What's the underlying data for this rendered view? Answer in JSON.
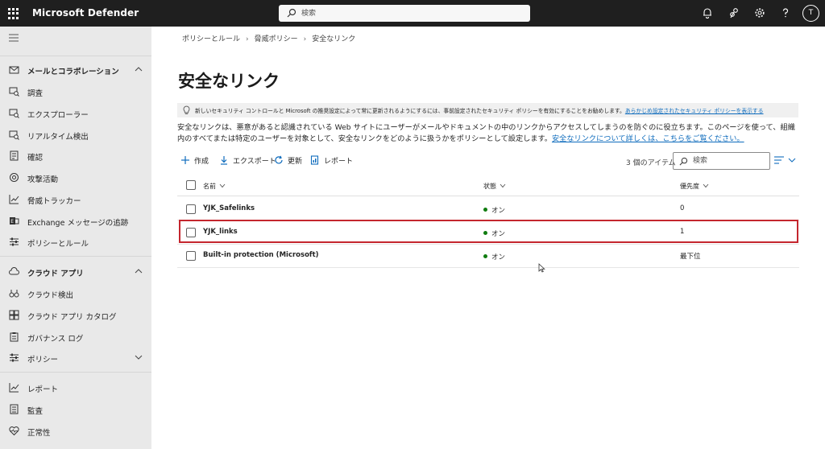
{
  "app": {
    "title": "Microsoft Defender",
    "search_placeholder": "検索",
    "avatar_initial": "T"
  },
  "sidebar": {
    "items": [
      {
        "label": "メールとコラボレーション",
        "group": true,
        "icon": "mail-icon"
      },
      {
        "label": "調査",
        "icon": "investigation-icon"
      },
      {
        "label": "エクスプローラー",
        "icon": "explorer-icon"
      },
      {
        "label": "リアルタイム検出",
        "icon": "realtime-icon"
      },
      {
        "label": "確認",
        "icon": "review-icon"
      },
      {
        "label": "攻撃活動",
        "icon": "campaign-icon"
      },
      {
        "label": "脅威トラッカー",
        "icon": "tracker-icon"
      },
      {
        "label": "Exchange メッセージの追跡",
        "icon": "exchange-icon"
      },
      {
        "label": "ポリシーとルール",
        "icon": "policy-icon"
      },
      {
        "label": "クラウド アプリ",
        "group": true,
        "icon": "cloud-icon"
      },
      {
        "label": "クラウド検出",
        "icon": "binoculars-icon"
      },
      {
        "label": "クラウド アプリ カタログ",
        "icon": "catalog-icon"
      },
      {
        "label": "ガバナンス ログ",
        "icon": "clipboard-icon"
      },
      {
        "label": "ポリシー",
        "icon": "sliders-icon"
      },
      {
        "label": "レポート",
        "icon": "chart-icon"
      },
      {
        "label": "監査",
        "icon": "audit-icon"
      },
      {
        "label": "正常性",
        "icon": "heart-icon"
      }
    ]
  },
  "breadcrumb": {
    "items": [
      "ポリシーとルール",
      "脅威ポリシー",
      "安全なリンク"
    ]
  },
  "page": {
    "title": "安全なリンク",
    "banner_text": "新しいセキュリティ コントロールと Microsoft の推奨設定によって常に更新されるようにするには、事前設定されたセキュリティ ポリシーを有効にすることをお勧めします。",
    "banner_link": "あらかじめ設定されたセキュリティ ポリシーを表示する",
    "description": "安全なリンクは、悪意があると認識されている Web サイトにユーザーがメールやドキュメントの中のリンクからアクセスしてしまうのを防ぐのに役立ちます。このページを使って、組織内のすべてまたは特定のユーザーを対象として、安全なリンクをどのように扱うかをポリシーとして設定します。",
    "description_link": "安全なリンクについて詳しくは、こちらをご覧ください。"
  },
  "toolbar": {
    "create": "作成",
    "export": "エクスポート",
    "refresh": "更新",
    "report": "レポート",
    "item_count": "3 個のアイテム",
    "search_placeholder": "検索"
  },
  "table": {
    "columns": [
      "名前",
      "状態",
      "優先度"
    ],
    "rows": [
      {
        "name": "YJK_Safelinks",
        "status": "オン",
        "priority": "0"
      },
      {
        "name": "YJK_links",
        "status": "オン",
        "priority": "1"
      },
      {
        "name": "Built-in protection (Microsoft)",
        "status": "オン",
        "priority": "最下位"
      }
    ]
  },
  "colors": {
    "topbar": "#1f1f1f",
    "link": "#0f6cbd",
    "status_on": "#107c10",
    "highlight": "#c4262e"
  }
}
